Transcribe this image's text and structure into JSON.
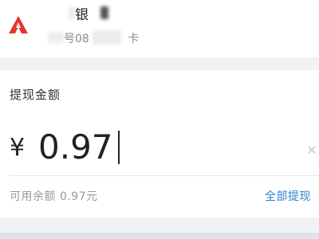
{
  "bank_card": {
    "name": "银",
    "number_text": "号08",
    "card_suffix": "卡",
    "brand_color": "#e8352b"
  },
  "withdraw": {
    "title": "提现金额",
    "currency_symbol": "¥",
    "amount": "0.97",
    "clear_icon": "clear-icon",
    "available_text": "可用余额 0.97元",
    "withdraw_all_label": "全部提现",
    "link_color": "#2f7fd6"
  }
}
